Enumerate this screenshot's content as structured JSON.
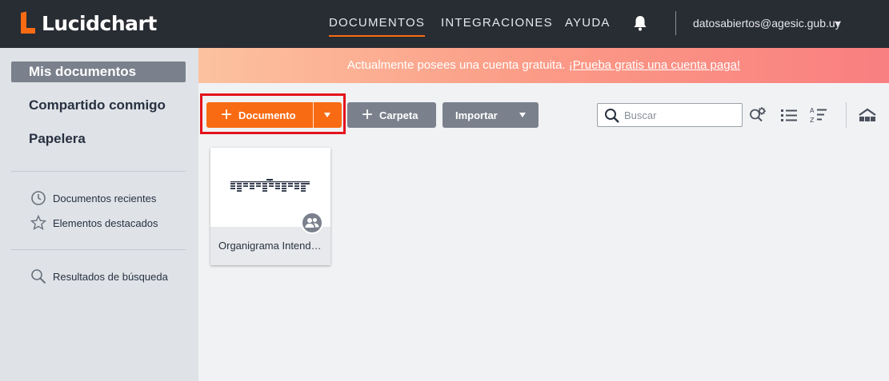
{
  "app": {
    "logo_text": "Lucidchart",
    "brand_color": "#f96b13"
  },
  "nav": {
    "documents": "DOCUMENTOS",
    "integrations": "INTEGRACIONES",
    "help": "AYUDA",
    "account_email": "datosabiertos@agesic.gub.uy"
  },
  "sidebar": {
    "main_items": [
      {
        "label": "Mis documentos",
        "selected": true
      },
      {
        "label": "Compartido conmigo",
        "selected": false
      },
      {
        "label": "Papelera",
        "selected": false
      }
    ],
    "sub_items": [
      {
        "label": "Documentos recientes",
        "icon": "clock-icon"
      },
      {
        "label": "Elementos destacados",
        "icon": "star-icon"
      }
    ],
    "search_results": {
      "label": "Resultados de búsqueda",
      "icon": "search-icon"
    }
  },
  "banner": {
    "text": "Actualmente posees una cuenta gratuita. ",
    "link": "¡Prueba gratis una cuenta paga!"
  },
  "toolbar": {
    "new_document": "Documento",
    "new_folder": "Carpeta",
    "import": "Importar",
    "search_placeholder": "Buscar"
  },
  "documents": [
    {
      "title": "Organigrama Intendencia",
      "shared": true
    }
  ]
}
